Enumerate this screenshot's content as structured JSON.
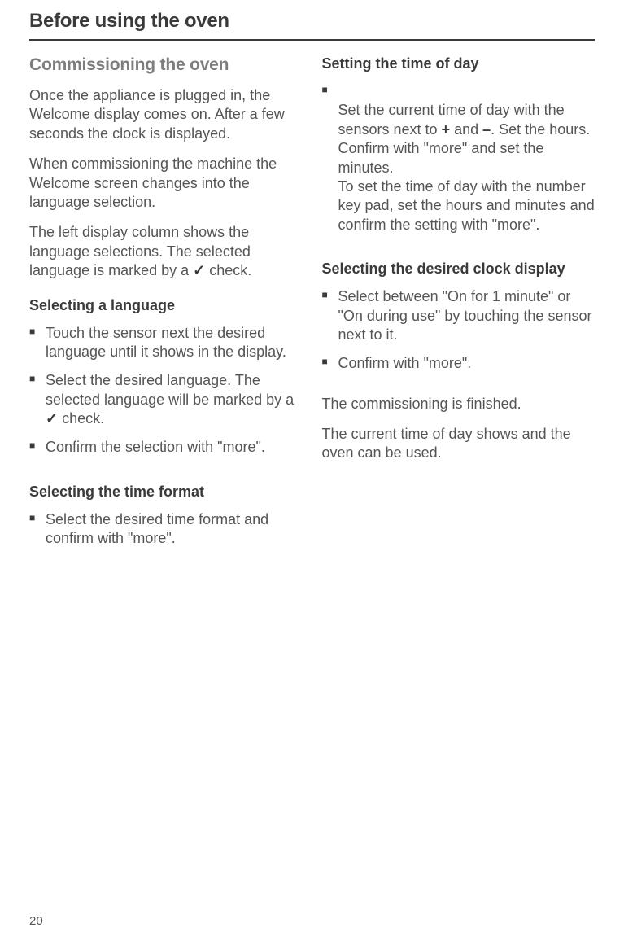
{
  "page_title": "Before using the oven",
  "page_number": "20",
  "left_column": {
    "section_heading": "Commissioning the oven",
    "intro_p1": "Once the appliance is plugged in, the Welcome display comes on. After a few seconds the clock is displayed.",
    "intro_p2": "When commissioning the machine the Welcome screen changes into the language selection.",
    "intro_p3_pre": "The left display column shows the language selections. The selected language is marked by a ",
    "intro_p3_post": " check.",
    "sub1_heading": "Selecting a language",
    "sub1_steps": [
      "Touch the sensor next the desired language until it shows in the display.",
      null,
      "Confirm the selection with \"more\"."
    ],
    "sub1_step2_pre": "Select the desired language. The selected language will be marked by a ",
    "sub1_step2_post": " check.",
    "sub2_heading": "Selecting the time format",
    "sub2_steps": [
      "Select the desired time format and confirm with \"more\"."
    ]
  },
  "right_column": {
    "sub1_heading": "Setting the time of day",
    "sub1_step1_pre": "Set the current time of day with the sensors next to ",
    "sub1_step1_plus": "+",
    "sub1_step1_mid": " and ",
    "sub1_step1_minus": "–",
    "sub1_step1_post": ". Set the hours. Confirm with \"more\" and set the minutes.\nTo set the time of day with the number key pad, set the hours and minutes and confirm the setting with \"more\".",
    "sub2_heading": "Selecting the desired clock display",
    "sub2_steps": [
      "Select between \"On for 1 minute\" or \"On during use\" by touching the sensor next to it.",
      "Confirm with \"more\"."
    ],
    "closing_p1": "The commissioning is finished.",
    "closing_p2": "The current time of day shows and the oven can be used."
  },
  "check_glyph": "✓"
}
